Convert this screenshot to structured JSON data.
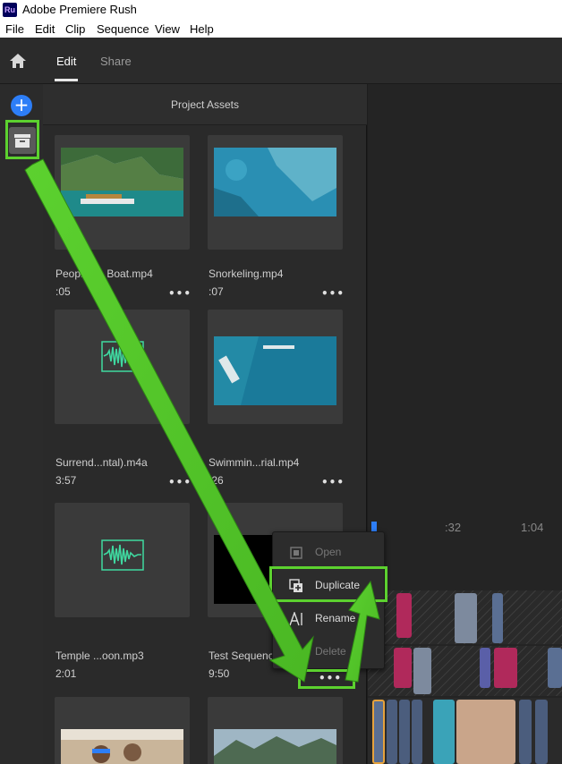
{
  "window": {
    "title": "Adobe Premiere Rush",
    "icon_text": "Ru"
  },
  "menu": [
    "File",
    "Edit",
    "Clip",
    "Sequence",
    "View",
    "Help"
  ],
  "nav": {
    "tabs": [
      "Edit",
      "Share"
    ],
    "active_tab": "Edit"
  },
  "panel": {
    "title": "Project Assets"
  },
  "assets": [
    {
      "name": "People on Boat.mp4",
      "duration": ":05",
      "kind": "video"
    },
    {
      "name": "Snorkeling.mp4",
      "duration": ":07",
      "kind": "video"
    },
    {
      "name": "Surrend...ntal).m4a",
      "duration": "3:57",
      "kind": "audio"
    },
    {
      "name": "Swimmin...rial.mp4",
      "duration": ":26",
      "kind": "video"
    },
    {
      "name": "Temple ...oon.mp3",
      "duration": "2:01",
      "kind": "audio"
    },
    {
      "name": "Test Sequence",
      "duration": "9:50",
      "kind": "sequence"
    }
  ],
  "timeline": {
    "ticks": [
      ":32",
      "1:04"
    ]
  },
  "context_menu": {
    "items": [
      {
        "label": "Open",
        "enabled": false,
        "icon": "open-icon"
      },
      {
        "label": "Duplicate",
        "enabled": true,
        "icon": "duplicate-icon"
      },
      {
        "label": "Rename",
        "enabled": true,
        "icon": "rename-icon"
      },
      {
        "label": "Delete",
        "enabled": false,
        "icon": "delete-icon"
      }
    ]
  },
  "more_glyph": "•••",
  "colors": {
    "accent": "#2d7ef7",
    "highlight": "#5cd12f",
    "audio_wave": "#3fd9a0"
  }
}
